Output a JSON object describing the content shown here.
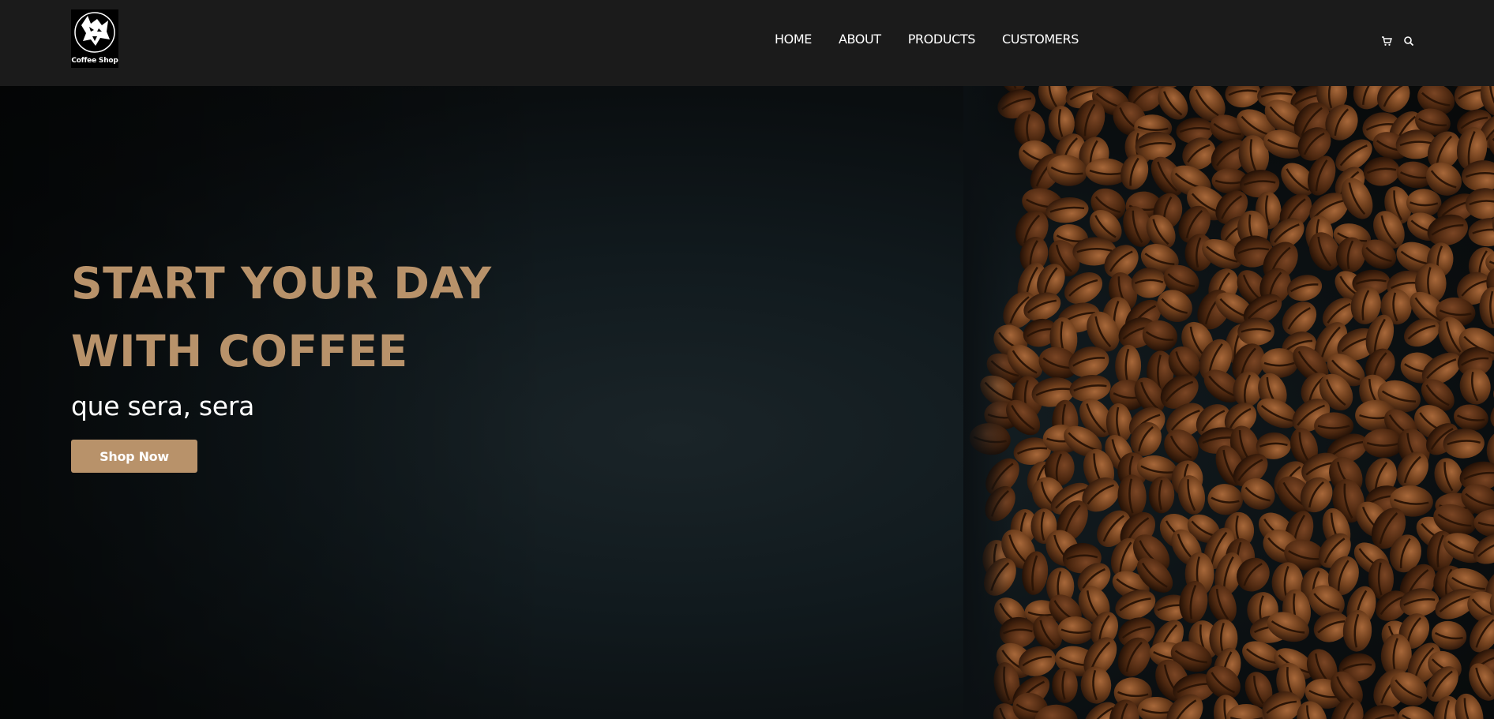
{
  "brand": {
    "name": "Coffee Shop",
    "logo_icon": "wolf-head-icon"
  },
  "nav": {
    "items": [
      {
        "label": "HOME"
      },
      {
        "label": "ABOUT"
      },
      {
        "label": "PRODUCTS"
      },
      {
        "label": "CUSTOMERS"
      }
    ]
  },
  "header_icons": [
    "cart-icon",
    "search-icon"
  ],
  "hero": {
    "headline_line1": "START YOUR DAY",
    "headline_line2": "WITH COFFEE",
    "tagline": "que sera, sera",
    "cta_label": "Shop Now",
    "image": "coffee-beans-on-dark-background"
  },
  "colors": {
    "header_bg": "#1b1b1b",
    "accent": "#b8926a",
    "text": "#ffffff",
    "hero_bg": "#111a1e"
  }
}
